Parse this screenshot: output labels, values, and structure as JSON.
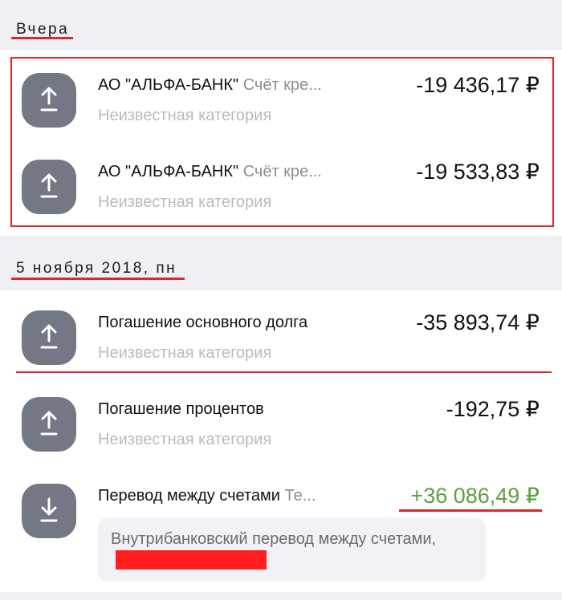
{
  "sections": [
    {
      "title": "Вчера",
      "transactions": [
        {
          "title": "АО \"АЛЬФА-БАНК\"",
          "subtitle": "Счёт кре...",
          "category": "Неизвестная категория",
          "amount": "-19 436,17 ₽",
          "direction": "outgoing"
        },
        {
          "title": "АО \"АЛЬФА-БАНК\"",
          "subtitle": "Счёт кре...",
          "category": "Неизвестная категория",
          "amount": "-19 533,83 ₽",
          "direction": "outgoing"
        }
      ]
    },
    {
      "title": "5 ноября 2018, пн",
      "transactions": [
        {
          "title": "Погашение основного долга",
          "category": "Неизвестная категория",
          "amount": "-35 893,74 ₽",
          "direction": "outgoing"
        },
        {
          "title": "Погашение процентов",
          "category": "Неизвестная категория",
          "amount": "-192,75 ₽",
          "direction": "outgoing"
        },
        {
          "title": "Перевод между счетами",
          "subtitle": "Те...",
          "amount": "+36 086,49 ₽",
          "direction": "incoming",
          "comment": "Внутрибанковский перевод между счетами,"
        }
      ]
    }
  ],
  "colors": {
    "accent_red": "#e0252b",
    "positive": "#5aa23a",
    "avatar": "#737884",
    "muted": "#b9bbc0",
    "background": "#efeff4"
  },
  "icons": {
    "outgoing": "upload-arrow-icon",
    "incoming": "download-arrow-icon"
  }
}
